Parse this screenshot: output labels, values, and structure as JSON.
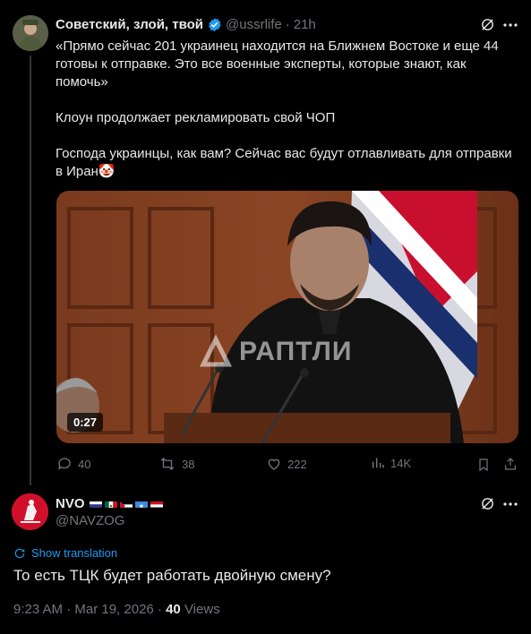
{
  "post": {
    "display_name": "Советский, злой, твой",
    "handle": "@ussrlife",
    "separator": "·",
    "time": "21h",
    "text_lines": [
      "«Прямо сейчас 201 украинец находится на Ближнем Востоке и еще 44 готовы к отправке. Это все военные эксперты, которые знают, как помочь»",
      "Клоун продолжает рекламировать свой ЧОП",
      "Господа украинцы, как вам? Сейчас вас будут отлавливать для отправки в Иран🤡"
    ],
    "video": {
      "duration": "0:27",
      "watermark": "РАПТЛИ"
    },
    "actions": {
      "replies": "40",
      "reposts": "38",
      "likes": "222",
      "views": "14K"
    }
  },
  "reply": {
    "display_name": "NVO",
    "handle": "@NAVZOG",
    "show_translation": "Show translation",
    "text": "То есть ТЦК будет работать двойную смену?",
    "timestamp": "9:23 AM · Mar 19, 2026 · ",
    "views_count": "40",
    "views_label": " Views"
  }
}
